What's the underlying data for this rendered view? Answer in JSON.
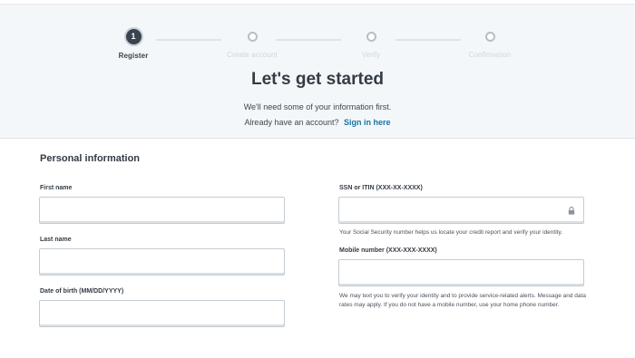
{
  "stepper": {
    "steps": [
      {
        "number": "1",
        "label": "Register",
        "state": "active"
      },
      {
        "label": "Create account",
        "state": "inactive"
      },
      {
        "label": "Verify",
        "state": "inactive"
      },
      {
        "label": "Confirmation",
        "state": "inactive"
      }
    ]
  },
  "hero": {
    "title": "Let's get started",
    "subtitle": "We'll need some of your information first.",
    "account_prompt": "Already have an account?",
    "signin_label": "Sign in here"
  },
  "section": {
    "title": "Personal information"
  },
  "fields": {
    "first_name": {
      "label": "First name",
      "value": ""
    },
    "last_name": {
      "label": "Last name",
      "value": ""
    },
    "dob": {
      "label": "Date of birth (MM/DD/YYYY)",
      "value": ""
    },
    "ssn": {
      "label": "SSN or ITIN (XXX-XX-XXXX)",
      "value": "",
      "help": "Your Social Security number helps us locate your credit report and verify your identity."
    },
    "mobile": {
      "label": "Mobile number (XXX-XXX-XXXX)",
      "value": "",
      "help": "We may text you to verify your identity and to provide service-related alerts. Message and data rates may apply. If you do not have a mobile number, use your home phone number."
    }
  },
  "colors": {
    "accent_link": "#1a73a8",
    "hero_bg": "#f4f7f9",
    "step_active": "#3a4350"
  },
  "icons": {
    "ssn_lock": "lock-icon"
  }
}
